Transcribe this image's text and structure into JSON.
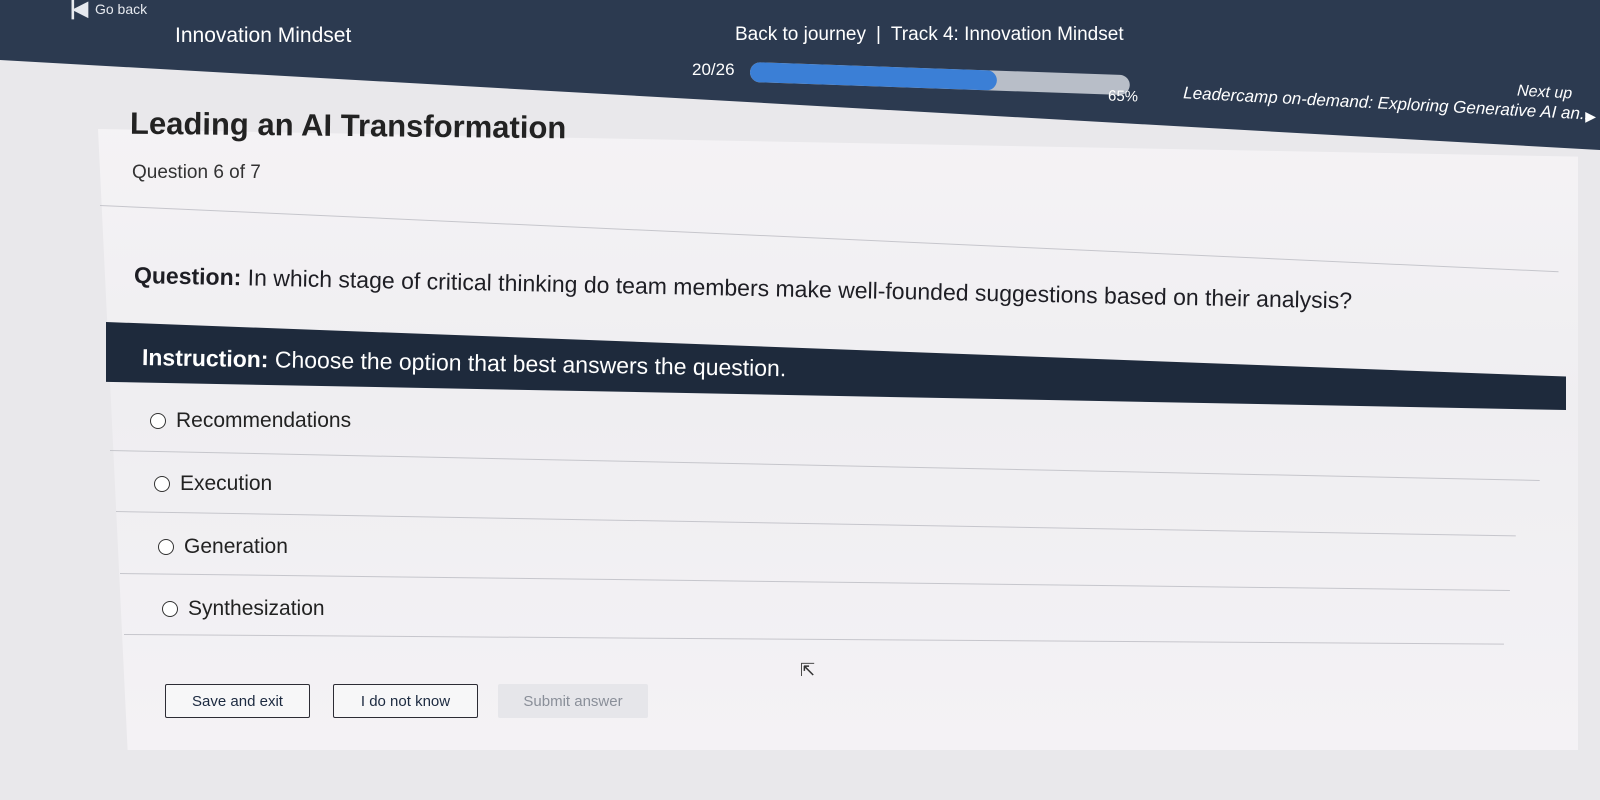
{
  "header": {
    "go_back_label": "Go back",
    "course_title": "Innovation Mindset",
    "back_to_journey": "Back to journey",
    "separator": "|",
    "track_title": "Track 4: Innovation Mindset",
    "progress_count": "20/26",
    "progress_percent_label": "65%",
    "progress_fraction": 0.65,
    "next_up_label": "Next up",
    "next_up_title": "Leadercamp on-demand: Exploring Generative AI an..."
  },
  "lesson": {
    "title": "Leading an AI Transformation",
    "question_count": "Question 6 of 7"
  },
  "question": {
    "label": "Question:",
    "text": "In which stage of critical thinking do team members make well-founded suggestions based on their analysis?"
  },
  "instruction": {
    "label": "Instruction:",
    "text": "Choose the option that best answers the question."
  },
  "options": [
    {
      "label": "Recommendations"
    },
    {
      "label": "Execution"
    },
    {
      "label": "Generation"
    },
    {
      "label": "Synthesization"
    }
  ],
  "buttons": {
    "save_exit": "Save and exit",
    "dont_know": "I do not know",
    "submit": "Submit answer"
  },
  "colors": {
    "header_bg": "#2c3a50",
    "instruction_bg": "#1e2a3c",
    "progress_fill": "#3b7fd6"
  }
}
